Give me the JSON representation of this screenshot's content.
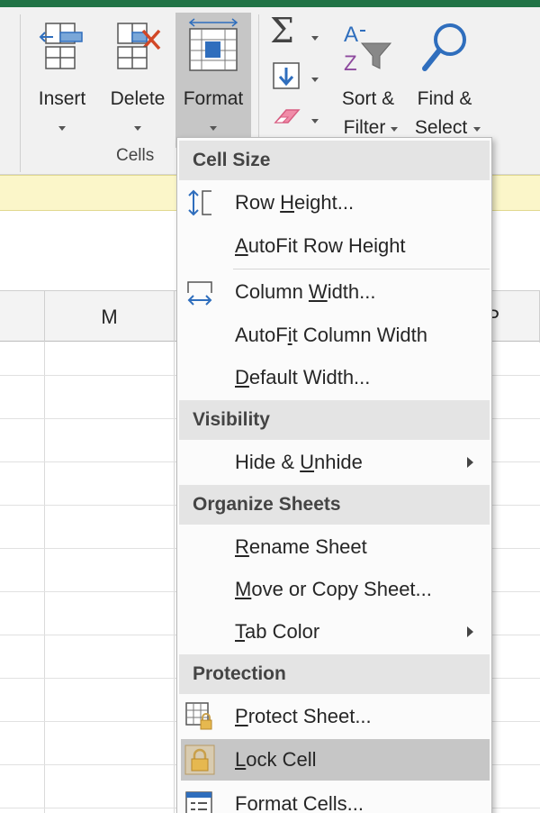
{
  "ribbon": {
    "insert": "Insert",
    "delete": "Delete",
    "format": "Format",
    "sort_line1": "Sort &",
    "sort_line2": "Filter",
    "find_line1": "Find &",
    "find_line2": "Select",
    "cells_group": "Cells"
  },
  "sheet": {
    "columns": [
      "M",
      "P"
    ]
  },
  "menu": {
    "cell_size_header": "Cell Size",
    "row_height_pre": "Row ",
    "row_height_u": "H",
    "row_height_post": "eight...",
    "autofit_row_u": "A",
    "autofit_row_post": "utoFit Row Height",
    "column_width_pre": "Column ",
    "column_width_u": "W",
    "column_width_post": "idth...",
    "autofit_col_pre": "AutoF",
    "autofit_col_u": "i",
    "autofit_col_post": "t Column Width",
    "default_width_u": "D",
    "default_width_post": "efault Width...",
    "visibility_header": "Visibility",
    "hide_pre": "Hide & ",
    "hide_u": "U",
    "hide_post": "nhide",
    "organize_header": "Organize Sheets",
    "rename_u": "R",
    "rename_post": "ename Sheet",
    "move_u": "M",
    "move_post": "ove or Copy Sheet...",
    "tab_u": "T",
    "tab_post": "ab Color",
    "protection_header": "Protection",
    "protect_u": "P",
    "protect_post": "rotect Sheet...",
    "lock_u": "L",
    "lock_post": "ock Cell",
    "format_cells": "Format Cells..."
  },
  "colors": {
    "excel_green": "#217346",
    "highlight": "#c6c6c6",
    "formula_bar": "#fbf6c9",
    "icon_blue": "#2f6ebd",
    "icon_red": "#d24726"
  }
}
